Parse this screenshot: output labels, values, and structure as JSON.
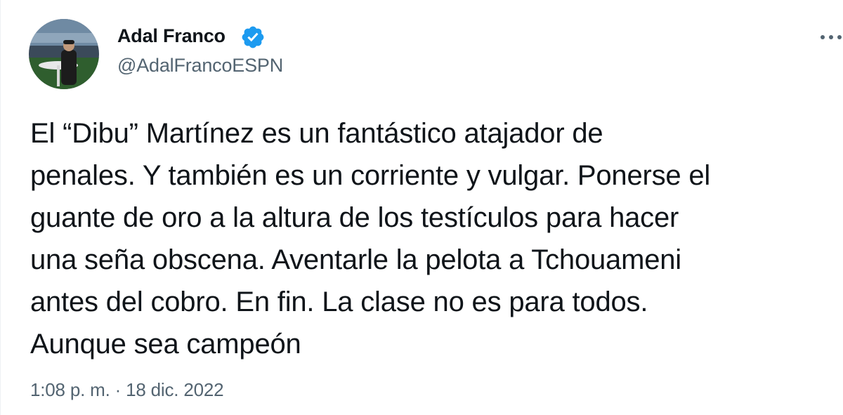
{
  "tweet": {
    "author": {
      "name": "Adal Franco",
      "handle": "@AdalFrancoESPN",
      "verified": true
    },
    "text": "El “Dibu” Martínez es un fantástico atajador de\npenales. Y también es un corriente y vulgar. Ponerse el\nguante de oro a la altura de los testículos para hacer\nuna seña obscena. Aventarle la pelota a Tchouameni\nantes del cobro. En fin. La clase no es para todos.\nAunque sea campeón",
    "timestamp": "1:08 p. m. · 18 dic. 2022"
  },
  "colors": {
    "verified_badge": "#1d9bf0",
    "primary_text": "#0f1419",
    "secondary_text": "#536471"
  },
  "icons": {
    "verified": "verified-badge-icon",
    "more": "more-options-icon"
  }
}
